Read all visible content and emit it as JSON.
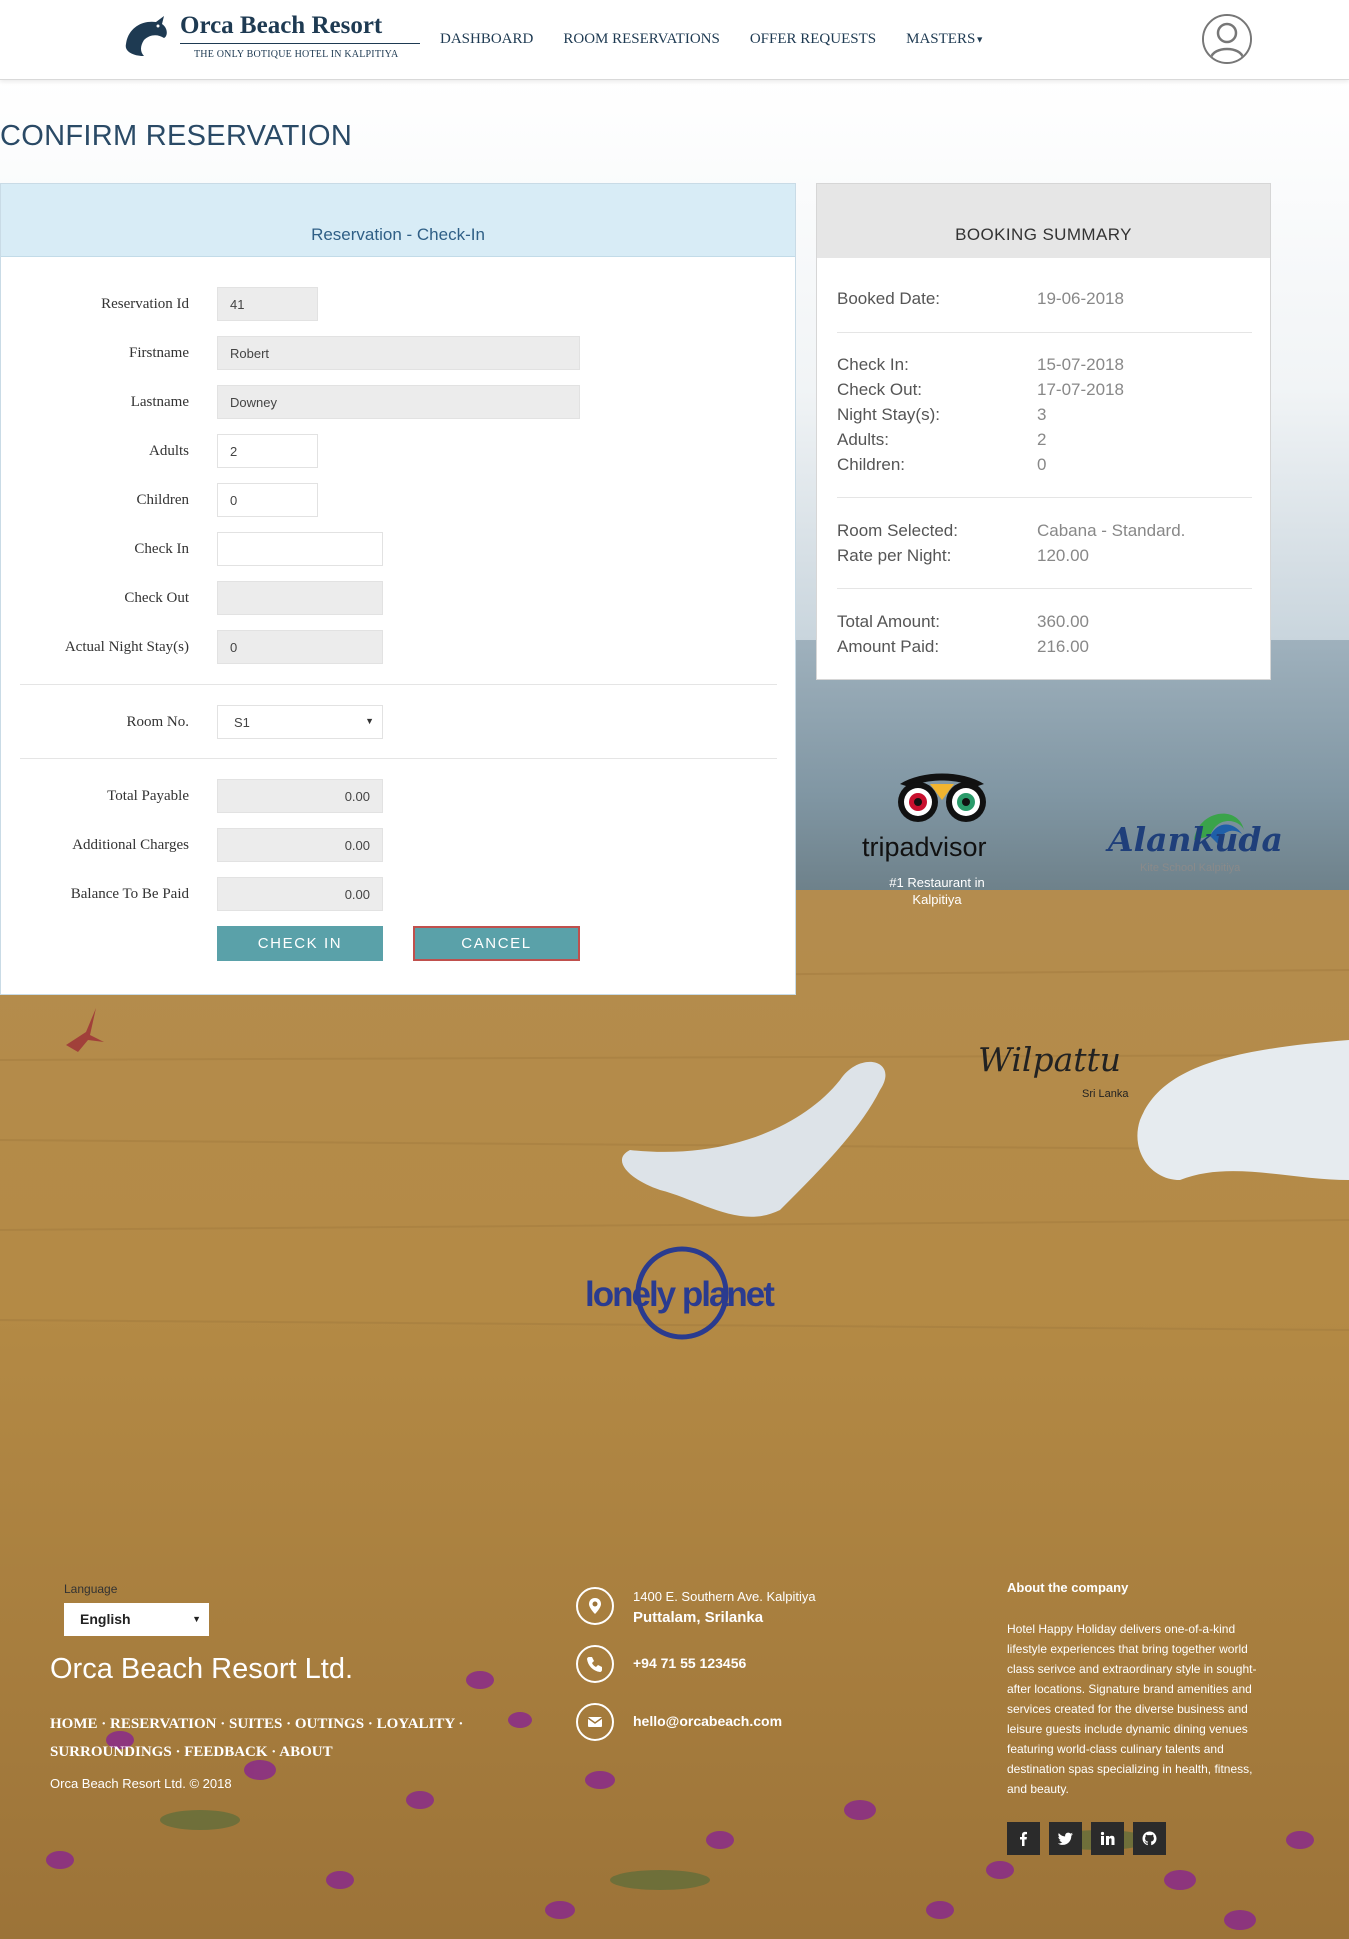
{
  "header": {
    "brand": "Orca Beach Resort",
    "tagline": "THE ONLY BOTIQUE HOTEL IN KALPITIYA",
    "nav": [
      "DASHBOARD",
      "ROOM RESERVATIONS",
      "OFFER REQUESTS",
      "MASTERS"
    ]
  },
  "page_title": "CONFIRM RESERVATION",
  "reservation": {
    "panel_title": "Reservation - Check-In",
    "fields": {
      "reservation_id": {
        "label": "Reservation Id",
        "value": "41"
      },
      "firstname": {
        "label": "Firstname",
        "value": "Robert"
      },
      "lastname": {
        "label": "Lastname",
        "value": "Downey"
      },
      "adults": {
        "label": "Adults",
        "value": "2"
      },
      "children": {
        "label": "Children",
        "value": "0"
      },
      "check_in": {
        "label": "Check In",
        "value": ""
      },
      "check_out": {
        "label": "Check Out",
        "value": ""
      },
      "night_stays": {
        "label": "Actual Night Stay(s)",
        "value": "0"
      },
      "room_no": {
        "label": "Room No.",
        "value": "S1"
      },
      "total_payable": {
        "label": "Total Payable",
        "value": "0.00"
      },
      "additional_charges": {
        "label": "Additional Charges",
        "value": "0.00"
      },
      "balance": {
        "label": "Balance To Be Paid",
        "value": "0.00"
      }
    },
    "checkin_label": "CHECK IN",
    "cancel_label": "CANCEL"
  },
  "summary": {
    "title": "BOOKING SUMMARY",
    "booked_date": {
      "label": "Booked Date:",
      "value": "19-06-2018"
    },
    "check_in": {
      "label": "Check In:",
      "value": "15-07-2018"
    },
    "check_out": {
      "label": "Check Out:",
      "value": "17-07-2018"
    },
    "night_stays": {
      "label": "Night Stay(s):",
      "value": "3"
    },
    "adults": {
      "label": "Adults:",
      "value": "2"
    },
    "children": {
      "label": "Children:",
      "value": "0"
    },
    "room": {
      "label": "Room Selected:",
      "value": "Cabana - Standard."
    },
    "rate": {
      "label": "Rate per Night:",
      "value": "120.00"
    },
    "total": {
      "label": "Total Amount:",
      "value": "360.00"
    },
    "paid": {
      "label": "Amount Paid:",
      "value": "216.00"
    }
  },
  "partners": {
    "tripadvisor": "tripadvisor",
    "tripadvisor_caption_1": "#1 Restaurant in",
    "tripadvisor_caption_2": "Kalpitiya",
    "alankuda": "Alankuda",
    "alankuda_caption": "Kite School Kalpitiya",
    "wilpattu": "Wilpattu",
    "wilpattu_caption": "Sri Lanka",
    "lonely_planet": "lonely planet"
  },
  "footer": {
    "language_label": "Language",
    "language": "English",
    "company": "Orca Beach Resort Ltd.",
    "links": [
      "HOME",
      "RESERVATION",
      "SUITES",
      "OUTINGS",
      "LOYALITY",
      "SURROUNDINGS",
      "FEEDBACK",
      "ABOUT"
    ],
    "copyright": "Orca Beach Resort Ltd. © 2018",
    "address_line1": "1400 E. Southern Ave. Kalpitiya",
    "address_line2": "Puttalam, Srilanka",
    "phone": "+94 71 55 123456",
    "email": "hello@orcabeach.com",
    "about_title": "About the company",
    "about_text": "Hotel Happy Holiday delivers one-of-a-kind lifestyle experiences that bring together world class serivce and extraordinary style in sought-after locations. Signature brand amenities and services created for the diverse business and leisure guests include dynamic dining venues featuring world-class culinary talents and destination spas specializing in health, fitness, and beauty."
  },
  "colors": {
    "navy": "#1e3a52",
    "panel_head": "#d8ecf6",
    "button": "#5aa1a9",
    "cancel_border": "#c0504d"
  }
}
